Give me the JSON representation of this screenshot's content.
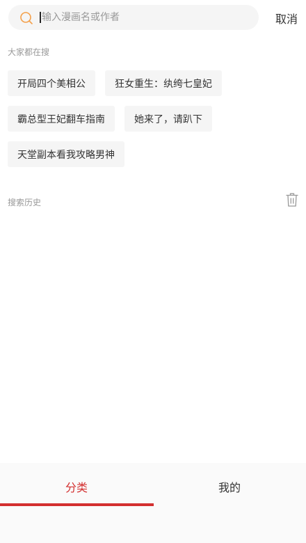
{
  "search": {
    "placeholder": "输入漫画名或作者",
    "cancel_label": "取消",
    "accent": "#f4a04a"
  },
  "hot": {
    "title": "大家都在搜",
    "tags": [
      "开局四个美相公",
      "狂女重生：纨绔七皇妃",
      "霸总型王妃翻车指南",
      "她来了，请趴下",
      "天堂副本看我攻略男神"
    ]
  },
  "history": {
    "title": "搜索历史",
    "clear_icon": "trash-icon"
  },
  "bottom_nav": {
    "tabs": [
      {
        "label": "分类",
        "active": true
      },
      {
        "label": "我的",
        "active": false
      }
    ],
    "active_color": "#d32f2f"
  }
}
